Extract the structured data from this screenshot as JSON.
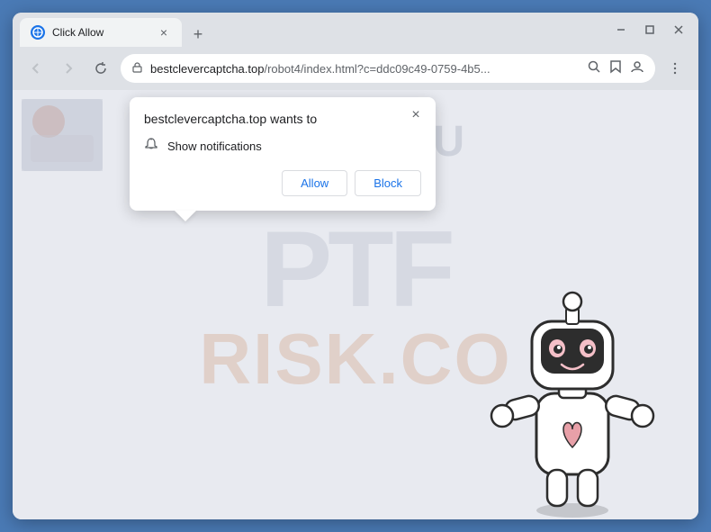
{
  "window": {
    "title": "Click Allow",
    "tab_favicon": "🌐",
    "close_label": "×",
    "minimize_label": "—",
    "maximize_label": "□",
    "window_close_label": "×"
  },
  "browser": {
    "new_tab_label": "+",
    "back_label": "←",
    "forward_label": "→",
    "refresh_label": "↻",
    "url": "bestclevercaptcha.top/robot4/index.html?c=ddc09c49-0759-4b5...",
    "url_domain": "bestclevercaptcha.top",
    "url_path": "/robot4/index.html?c=ddc09c49-0759-4b5...",
    "search_icon": "⌕",
    "bookmark_icon": "☆",
    "account_icon": "👤",
    "menu_icon": "⋮",
    "lock_icon": "🔒"
  },
  "popup": {
    "title": "bestclevercaptcha.top wants to",
    "notification_label": "Show notifications",
    "allow_label": "Allow",
    "block_label": "Block",
    "close_label": "×"
  },
  "page": {
    "watermark_ptf": "PTF",
    "watermark_risk": "RISK.CO",
    "you_text": "YOU"
  }
}
